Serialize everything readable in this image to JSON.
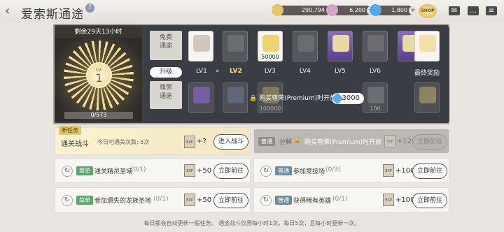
{
  "header": {
    "title": "爱索斯通途",
    "help": "?",
    "currencies": [
      {
        "name": "gold",
        "value": "290,794",
        "color": "#e3c56a"
      },
      {
        "name": "gem-pink",
        "value": "6,200",
        "color": "#d6a3c9"
      },
      {
        "name": "crystal",
        "value": "1,800",
        "color": "#5aa9e6"
      }
    ],
    "shop_label": "SHOP"
  },
  "level_panel": {
    "time_left": "剩余29天13小时",
    "lv_label": "LV.",
    "level": "1",
    "progress": "0/573",
    "progress_fraction": 0
  },
  "track": {
    "free_label": "免费\n通途",
    "premium_label": "尊荣\n通途",
    "upgrade_button": "升级",
    "levels": [
      "LV1",
      "LV2",
      "LV3",
      "LV4",
      "LV5",
      "LV6",
      "最终奖励"
    ],
    "current_level_index": 1,
    "free_rewards": [
      "",
      "",
      "50000",
      "",
      "",
      "",
      ""
    ],
    "premium_rewards": [
      "",
      "",
      "100000",
      "",
      "",
      "100",
      ""
    ],
    "lock_notice": "购买尊荣(Premium)时开放",
    "premium_cost": "3000"
  },
  "tasks": {
    "new_tag": "新任务",
    "battle": {
      "title": "通关战斗",
      "sub": "今日可通关次数: 5次",
      "reward": "+?",
      "button": "进入战斗"
    },
    "locked": {
      "tag": "普通",
      "text": "分解",
      "lock_text": "购买尊荣(Premium)时开放",
      "reward": "+120",
      "button": "立即前往"
    },
    "list": [
      {
        "tag": "简单",
        "text": "通关精灵圣域",
        "count": "(0/1)",
        "reward": "+50",
        "button": "立即前往"
      },
      {
        "tag": "普通",
        "text": "参加竞技场",
        "count": "(0/3)",
        "reward": "+100",
        "button": "立即前往"
      },
      {
        "tag": "简单",
        "text": "参加遗失的龙族圣地",
        "count": "(0/1)",
        "reward": "+50",
        "button": "立即前往"
      },
      {
        "tag": "普通",
        "text": "获得稀有英雄",
        "count": "(0/1)",
        "reward": "+100",
        "button": "立即前往"
      }
    ]
  },
  "footer": "每日都会自动更新一般任务。 通途战斗仅限每小时1次，每日5次，且每小时更新一次。"
}
